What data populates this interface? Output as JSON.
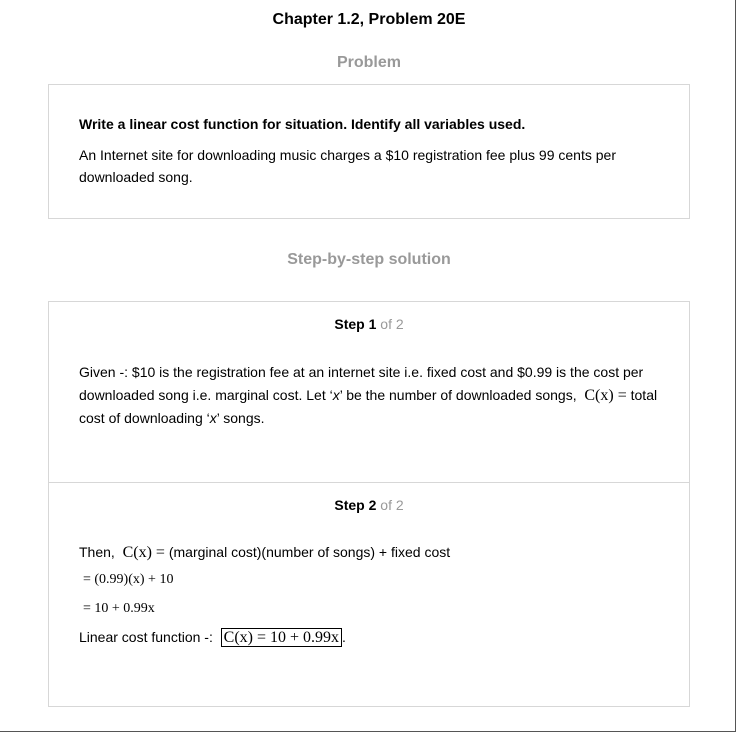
{
  "chapter_title": "Chapter 1.2, Problem 20E",
  "problem": {
    "heading": "Problem",
    "instruction": "Write a linear cost function for situation. Identify all variables used.",
    "text": "An Internet site for downloading music charges a $10 registration fee plus 99 cents per downloaded song."
  },
  "solution_heading": "Step-by-step solution",
  "steps": [
    {
      "number": "1",
      "of": "of 2",
      "text_a": "Given -: $10 is the registration fee at an internet site i.e. fixed cost and $0.99 is the cost per downloaded song i.e. marginal cost. Let ‘",
      "var": "x",
      "text_b": "’ be the number of downloaded songs,",
      "math": "C(x) =",
      "text_c": "total cost of downloading ‘",
      "var2": "x",
      "text_d": "’ songs."
    },
    {
      "number": "2",
      "of": "of 2",
      "then_label": "Then,",
      "then_math": "C(x) =",
      "then_text": "(marginal cost)(number of songs) + fixed cost",
      "eq1": "= (0.99)(x) + 10",
      "eq2": "= 10 + 0.99x",
      "result_label": "Linear cost function -:",
      "result_math": "C(x) = 10 + 0.99x",
      "result_end": "."
    }
  ]
}
